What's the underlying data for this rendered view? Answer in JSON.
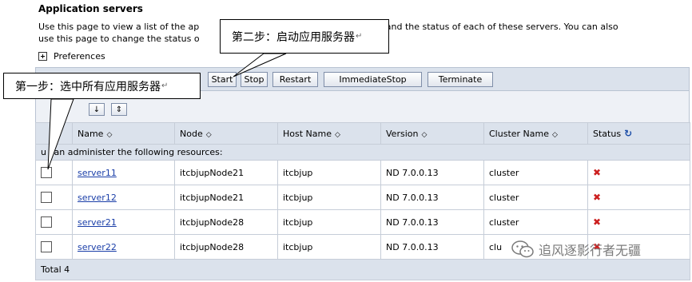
{
  "page": {
    "title": "Application servers",
    "description_line1": "Use this page to view a list of the ap",
    "description_line1_end": "ent and the status of each of these servers. You can also",
    "description_line2": "use this page to change the status o",
    "preferences": "Preferences"
  },
  "toolbar": {
    "start": "Start",
    "stop": "Stop",
    "restart": "Restart",
    "immediate_stop": "ImmediateStop",
    "terminate": "Terminate"
  },
  "table": {
    "columns": [
      "Name",
      "Node",
      "Host Name",
      "Version",
      "Cluster Name",
      "Status"
    ],
    "resources_text": "u can administer the following resources:",
    "rows": [
      {
        "name": "server11",
        "node": "itcbjupNode21",
        "host": "itcbjup",
        "version": "ND 7.0.0.13",
        "cluster": "cluster"
      },
      {
        "name": "server12",
        "node": "itcbjupNode21",
        "host": "itcbjup",
        "version": "ND 7.0.0.13",
        "cluster": "cluster"
      },
      {
        "name": "server21",
        "node": "itcbjupNode28",
        "host": "itcbjup",
        "version": "ND 7.0.0.13",
        "cluster": "cluster"
      },
      {
        "name": "server22",
        "node": "itcbjupNode28",
        "host": "itcbjup",
        "version": "ND 7.0.0.13",
        "cluster": "clu"
      }
    ],
    "total": "Total 4"
  },
  "callouts": {
    "step1": "第一步：选中所有应用服务器",
    "step2": "第二步：启动应用服务器",
    "return_mark": "↵"
  },
  "watermark": {
    "text": "追风逐影行者无疆"
  },
  "icons": {
    "status_stopped": "x-icon",
    "sort": "sort-icon",
    "refresh": "refresh-icon",
    "expand": "plus-icon"
  },
  "colors": {
    "link": "#1a3ea8",
    "stopped": "#cc1f1f",
    "header_bg": "#dbe2ec"
  }
}
